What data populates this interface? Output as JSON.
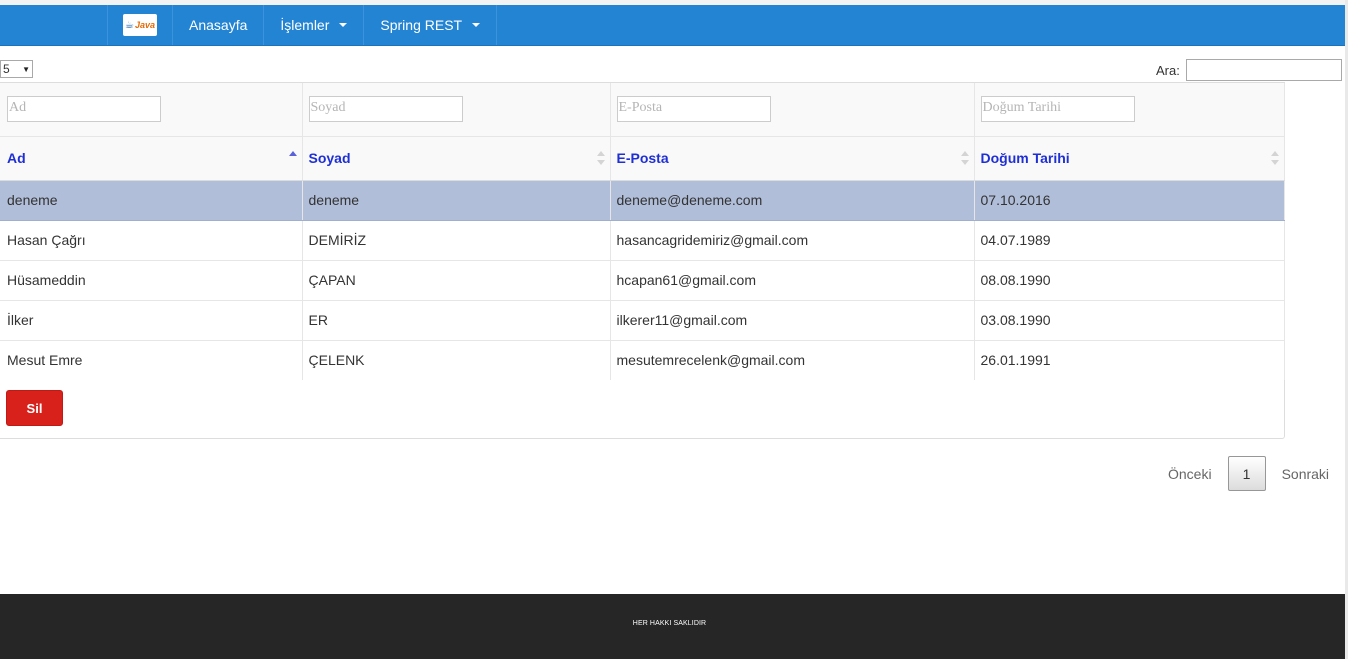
{
  "navbar": {
    "logo_text": "Java",
    "items": [
      {
        "label": "Anasayfa"
      },
      {
        "label": "İşlemler"
      },
      {
        "label": "Spring REST"
      }
    ]
  },
  "length_select": {
    "value": "5"
  },
  "search": {
    "label": "Ara:",
    "value": ""
  },
  "filters": {
    "ad": "Ad",
    "soyad": "Soyad",
    "eposta": "E-Posta",
    "dogum": "Doğum Tarihi"
  },
  "columns": [
    "Ad",
    "Soyad",
    "E-Posta",
    "Doğum Tarihi"
  ],
  "sort": {
    "column": "Ad",
    "direction": "asc"
  },
  "rows": [
    {
      "ad": "deneme",
      "soyad": "deneme",
      "eposta": "deneme@deneme.com",
      "dogum": "07.10.2016",
      "selected": true
    },
    {
      "ad": "Hasan Çağrı",
      "soyad": "DEMİRİZ",
      "eposta": "hasancagridemiriz@gmail.com",
      "dogum": "04.07.1989",
      "selected": false
    },
    {
      "ad": "Hüsameddin",
      "soyad": "ÇAPAN",
      "eposta": "hcapan61@gmail.com",
      "dogum": "08.08.1990",
      "selected": false
    },
    {
      "ad": "İlker",
      "soyad": "ER",
      "eposta": "ilkerer11@gmail.com",
      "dogum": "03.08.1990",
      "selected": false
    },
    {
      "ad": "Mesut Emre",
      "soyad": "ÇELENK",
      "eposta": "mesutemrecelenk@gmail.com",
      "dogum": "26.01.1991",
      "selected": false
    }
  ],
  "delete_button": {
    "label": "Sil"
  },
  "pagination": {
    "previous": "Önceki",
    "current_page": "1",
    "next": "Sonraki"
  },
  "footer": {
    "text": "HER HAKKI SAKLIDIR"
  },
  "colors": {
    "navbar": "#2384d3",
    "header_text": "#1f2fd6",
    "selected_row": "#b0bed9",
    "delete_button": "#d9211c",
    "footer": "#262626"
  }
}
